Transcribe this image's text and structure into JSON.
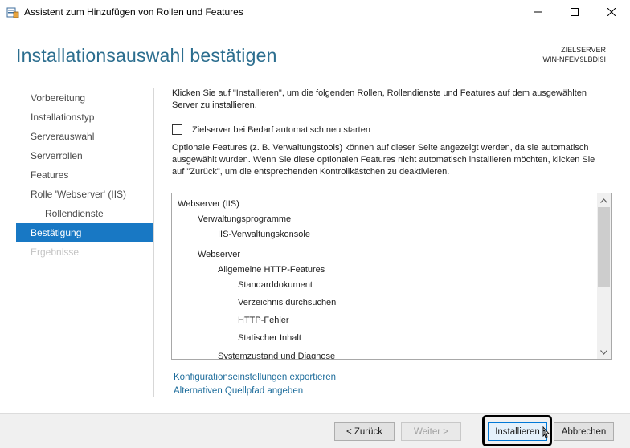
{
  "window": {
    "title": "Assistent zum Hinzufügen von Rollen und Features"
  },
  "header": {
    "page_title": "Installationsauswahl bestätigen",
    "server_label": "ZIELSERVER",
    "server_name": "WIN-NFEM9LBDI9I"
  },
  "nav": {
    "items": [
      {
        "label": "Vorbereitung"
      },
      {
        "label": "Installationstyp"
      },
      {
        "label": "Serverauswahl"
      },
      {
        "label": "Serverrollen"
      },
      {
        "label": "Features"
      },
      {
        "label": "Rolle 'Webserver' (IIS)"
      },
      {
        "label": "Rollendienste"
      },
      {
        "label": "Bestätigung"
      },
      {
        "label": "Ergebnisse"
      }
    ]
  },
  "content": {
    "intro": "Klicken Sie auf \"Installieren\", um die folgenden Rollen, Rollendienste und Features auf dem ausgewählten Server zu installieren.",
    "restart_label": "Zielserver bei Bedarf automatisch neu starten",
    "restart_checked": false,
    "optional_text": "Optionale Features (z. B. Verwaltungstools) können auf dieser Seite angezeigt werden, da sie automatisch ausgewählt wurden. Wenn Sie diese optionalen Features nicht automatisch installieren möchten, klicken Sie auf \"Zurück\", um die entsprechenden Kontrollkästchen zu deaktivieren.",
    "features": [
      {
        "label": "Webserver (IIS)"
      },
      {
        "label": "Verwaltungsprogramme"
      },
      {
        "label": "IIS-Verwaltungskonsole"
      },
      {
        "label": "Webserver"
      },
      {
        "label": "Allgemeine HTTP-Features"
      },
      {
        "label": "Standarddokument"
      },
      {
        "label": "Verzeichnis durchsuchen"
      },
      {
        "label": "HTTP-Fehler"
      },
      {
        "label": "Statischer Inhalt"
      },
      {
        "label": "Systemzustand und Diagnose"
      }
    ],
    "export_link": "Konfigurationseinstellungen exportieren",
    "source_link": "Alternativen Quellpfad angeben"
  },
  "footer": {
    "back_label": "< Zurück",
    "next_label": "Weiter >",
    "install_label": "Installieren",
    "cancel_label": "Abbrechen"
  },
  "colors": {
    "accent": "#1878c4",
    "title": "#2c6e8f",
    "link": "#1d6c9b"
  }
}
